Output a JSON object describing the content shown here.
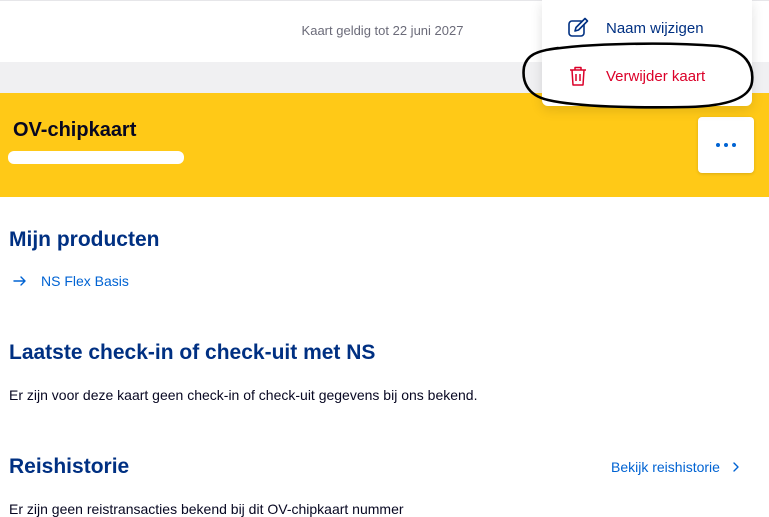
{
  "card_validity": "Kaart geldig tot 22 juni 2027",
  "menu": {
    "rename_label": "Naam wijzigen",
    "delete_label": "Verwijder kaart"
  },
  "card": {
    "title": "OV-chipkaart"
  },
  "products": {
    "heading": "Mijn producten",
    "items": [
      {
        "label": "NS Flex Basis"
      }
    ]
  },
  "last_checkin": {
    "heading": "Laatste check-in of check-uit met NS",
    "text": "Er zijn voor deze kaart geen check-in of check-uit gegevens bij ons bekend."
  },
  "travel_history": {
    "heading": "Reishistorie",
    "link_label": "Bekijk reishistorie",
    "text": "Er zijn geen reistransacties bekend bij dit OV-chipkaart nummer"
  },
  "icons": {
    "rename": "pencil-edit-icon",
    "delete": "trash-icon",
    "more": "more-dots-icon",
    "product_arrow": "arrow-right-icon",
    "history_chevron": "chevron-right-icon"
  },
  "colors": {
    "ns_yellow": "#ffc917",
    "ns_blue": "#003082",
    "link_blue": "#0063d3",
    "delete_red": "#db0029"
  }
}
